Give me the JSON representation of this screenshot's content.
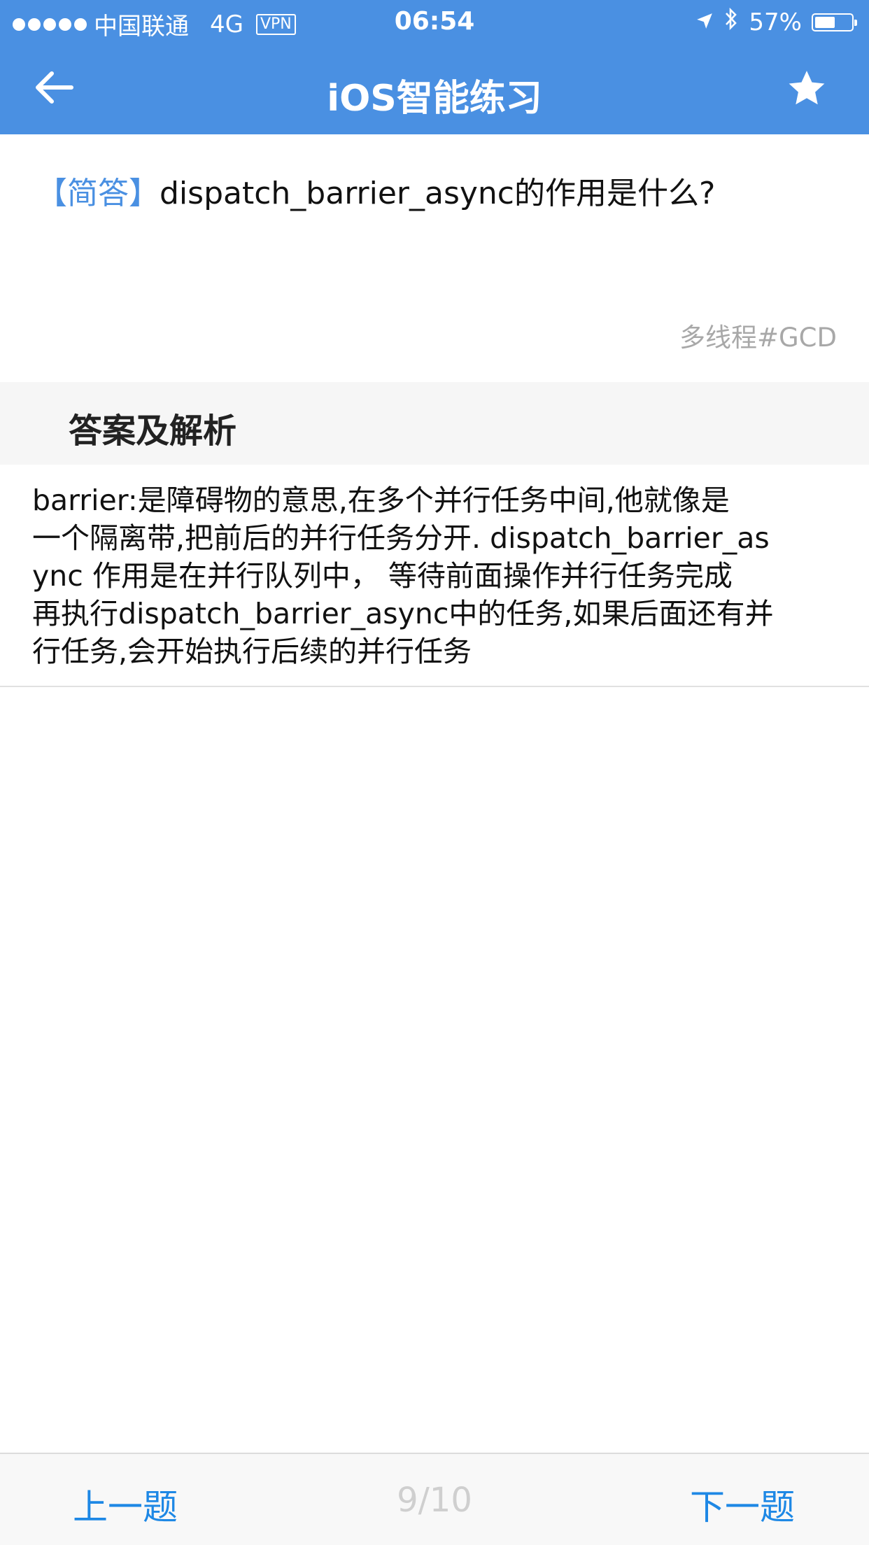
{
  "status_bar": {
    "carrier": "中国联通",
    "network": "4G",
    "vpn": "VPN",
    "time": "06:54",
    "battery_percent_label": "57%",
    "battery_level": 0.57,
    "icons": [
      "signal-dots-icon",
      "location-arrow-icon",
      "bluetooth-icon",
      "battery-icon"
    ]
  },
  "nav": {
    "title": "iOS智能练习",
    "back_icon": "arrow-left-icon",
    "favorite_icon": "star-icon"
  },
  "question": {
    "type_tag": "【简答】",
    "text": "dispatch_barrier_async的作用是什么?",
    "topic_tag": "多线程#GCD"
  },
  "answer": {
    "heading": "答案及解析",
    "lines": [
      "barrier:是障碍物的意思,在多个并行任务中间,他就像是",
      "一个隔离带,把前后的并行任务分开. dispatch_barrier_as",
      "ync 作用是在并行队列中， 等待前面操作并行任务完成",
      "再执行dispatch_barrier_async中的任务,如果后面还有并",
      "行任务,会开始执行后续的并行任务"
    ]
  },
  "bottom_bar": {
    "prev_label": "上一题",
    "page": "9/10",
    "next_label": "下一题"
  },
  "colors": {
    "header": "#4a90e2",
    "accent": "#1e88e5",
    "section_bg": "#f6f6f6"
  }
}
